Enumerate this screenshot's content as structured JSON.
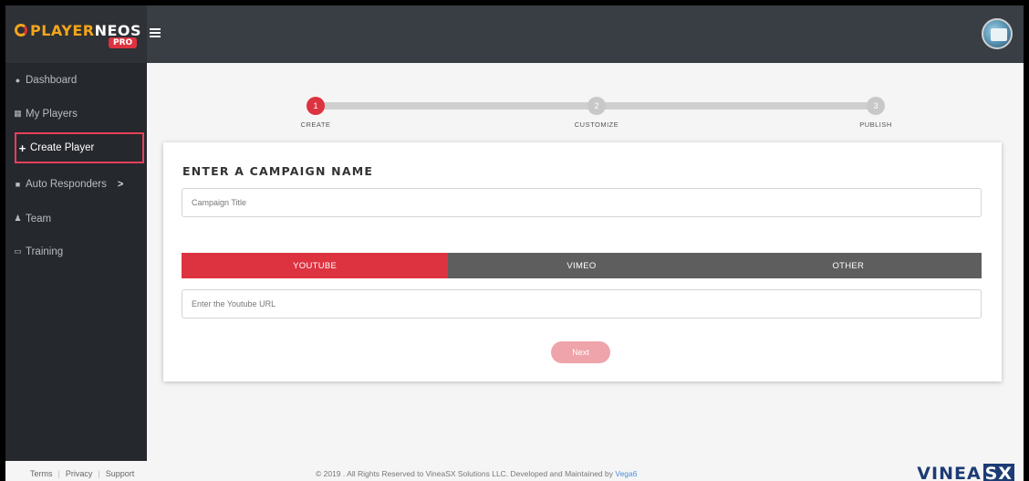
{
  "app": {
    "logo_prefix": "PLAYER",
    "logo_suffix": "NEOS",
    "badge": "PRO"
  },
  "sidebar": {
    "items": [
      {
        "label": "Dashboard",
        "icon": "dashboard-icon"
      },
      {
        "label": "My Players",
        "icon": "table-icon"
      },
      {
        "label": "Create Player",
        "icon": "plus-icon",
        "active": true
      },
      {
        "label": "Auto Responders",
        "icon": "folder-icon",
        "chevron": ">"
      },
      {
        "label": "Team",
        "icon": "team-icon"
      },
      {
        "label": "Training",
        "icon": "monitor-icon"
      }
    ]
  },
  "stepper": {
    "steps": [
      {
        "number": "1",
        "label": "CREATE",
        "status": "active"
      },
      {
        "number": "2",
        "label": "CUSTOMIZE",
        "status": "inactive"
      },
      {
        "number": "3",
        "label": "PUBLISH",
        "status": "inactive"
      }
    ]
  },
  "form": {
    "title": "ENTER A CAMPAIGN NAME",
    "campaign_placeholder": "Campaign Title",
    "tabs": [
      {
        "label": "YOUTUBE",
        "selected": true
      },
      {
        "label": "VIMEO",
        "selected": false
      },
      {
        "label": "OTHER",
        "selected": false
      }
    ],
    "url_placeholder": "Enter the Youtube URL",
    "next_label": "Next"
  },
  "footer": {
    "links": [
      "Terms",
      "Privacy",
      "Support"
    ],
    "copyright": "© 2019 . All Rights Reserved to VineaSX Solutions LLC. Developed and Maintained by ",
    "developer": "Vega6",
    "brand_prefix": "VINEA",
    "brand_box": "SX"
  },
  "colors": {
    "accent": "#dd3340",
    "tab_inactive": "#5e5e5e",
    "sidebar_bg": "#25282d",
    "topbar_bg": "#393d44",
    "step_inactive": "#c8c8c8"
  }
}
